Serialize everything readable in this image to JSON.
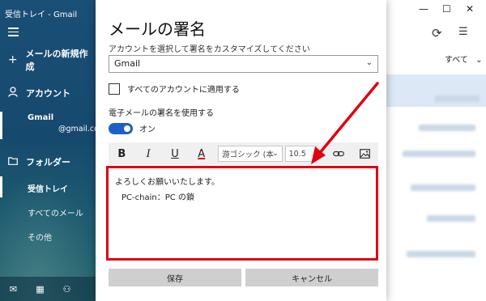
{
  "sidebar": {
    "window_title": "受信トレイ - Gmail",
    "new_mail": "メールの新規作成",
    "accounts_header": "アカウント",
    "account_name": "Gmail",
    "account_email": "@gmail.com",
    "folders_header": "フォルダー",
    "folders": [
      "受信トレイ",
      "すべてのメール",
      "その他"
    ]
  },
  "dialog": {
    "title": "メールの署名",
    "subtitle": "アカウントを選択して署名をカスタマイズしてください",
    "account_select_value": "Gmail",
    "apply_all_label": "すべてのアカウントに適用する",
    "use_signature_label": "電子メールの署名を使用する",
    "toggle_label": "オン",
    "toggle_on": true,
    "toolbar": {
      "bold": "B",
      "italic": "I",
      "underline": "U",
      "font_color": "A",
      "font_name": "游ゴシック (本",
      "font_size": "10.5"
    },
    "signature_lines": [
      "よろしくお願いいたします。",
      "PC-chain：PC の鎖"
    ],
    "save_label": "保存",
    "cancel_label": "キャンセル"
  },
  "message_list": {
    "filter_label": "すべて"
  },
  "colors": {
    "sidebar_bg": "#1a4f76",
    "toggle_on": "#1d5fc8",
    "highlight_red": "#e00012"
  }
}
